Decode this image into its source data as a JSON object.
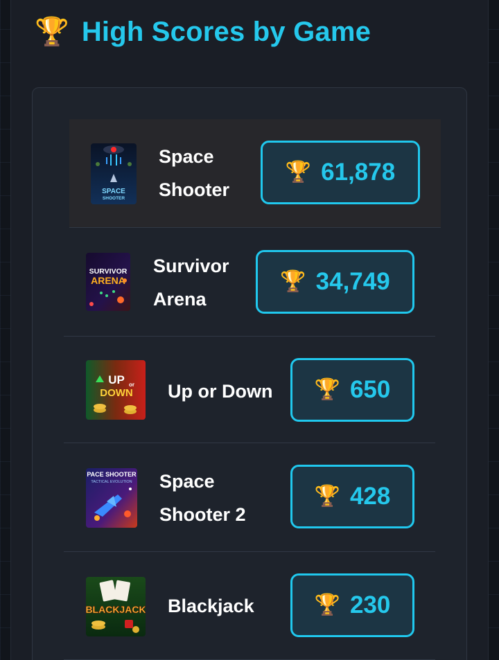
{
  "header": {
    "icon": "trophy-icon",
    "trophy_glyph": "🏆",
    "title": "High Scores by Game"
  },
  "colors": {
    "accent": "#25c8ec",
    "background": "#11151b",
    "card": "#1e232c",
    "selected_row": "#27272b",
    "score_box": "#1c3544"
  },
  "games": [
    {
      "name_line1": "Space",
      "name_line2": "Shooter",
      "score": "61,878",
      "thumb_icon": "space-shooter-thumbnail",
      "thumb_text1": "SPACE",
      "thumb_text2": "SHOOTER",
      "selected": true
    },
    {
      "name_line1": "Survivor",
      "name_line2": "Arena",
      "score": "34,749",
      "thumb_icon": "survivor-arena-thumbnail",
      "thumb_text1": "SURVIVOR",
      "thumb_text2": "ARENA"
    },
    {
      "name_line1": "Up or Down",
      "score": "650",
      "thumb_icon": "up-or-down-thumbnail",
      "thumb_text1": "UP",
      "thumb_text_or": "or",
      "thumb_text2": "DOWN"
    },
    {
      "name_line1": "Space",
      "name_line2": "Shooter 2",
      "score": "428",
      "thumb_icon": "space-shooter-2-thumbnail",
      "thumb_text1": "PACE SHOOTER",
      "thumb_text2": "TACTICAL EVOLUTION"
    },
    {
      "name_line1": "Blackjack",
      "score": "230",
      "thumb_icon": "blackjack-thumbnail",
      "thumb_text1": "BLACKJACK"
    }
  ]
}
